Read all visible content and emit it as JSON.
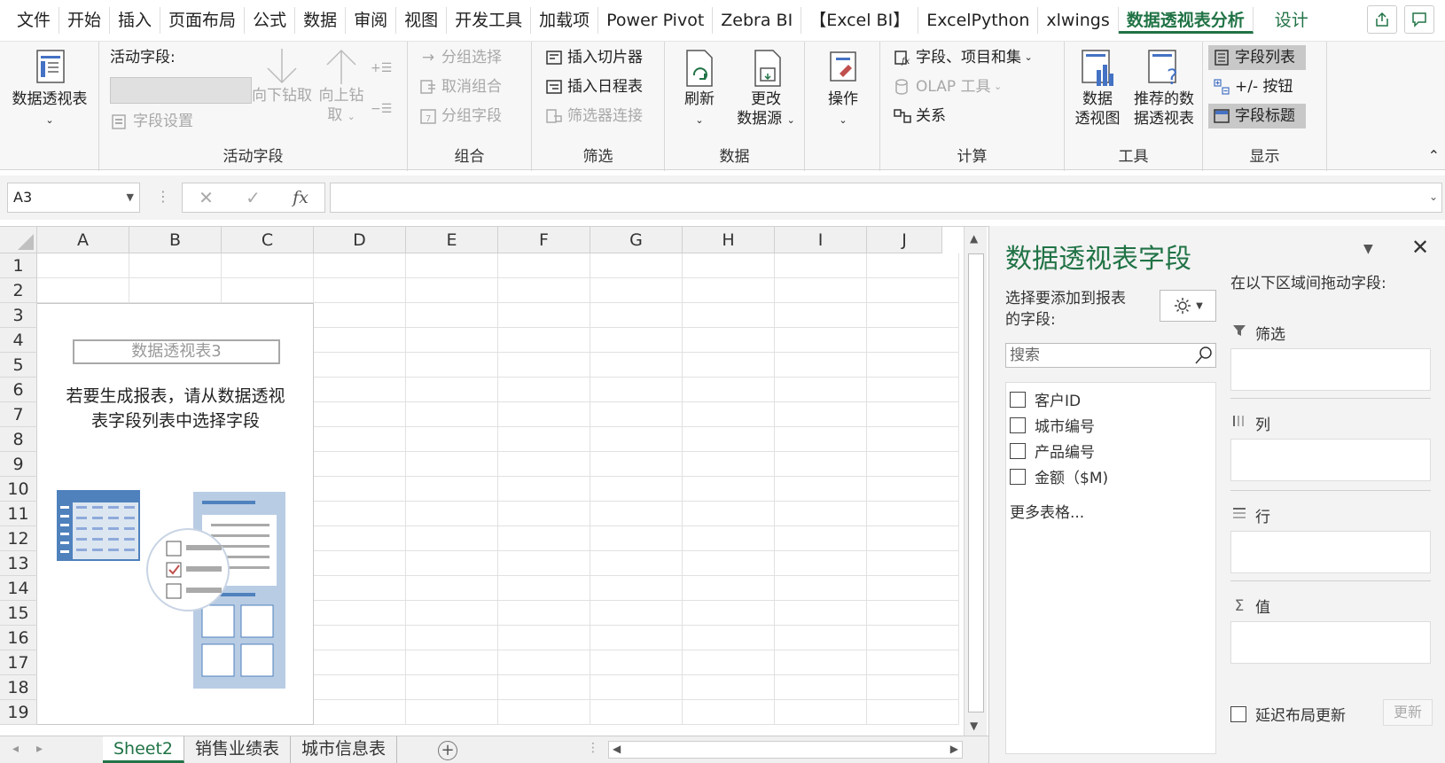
{
  "menu": {
    "tabs": [
      "文件",
      "开始",
      "插入",
      "页面布局",
      "公式",
      "数据",
      "审阅",
      "视图",
      "开发工具",
      "加载项",
      "Power Pivot",
      "Zebra BI",
      "【Excel BI】",
      "ExcelPython",
      "xlwings",
      "数据透视表分析",
      "设计"
    ],
    "active_tab": "数据透视表分析"
  },
  "ribbon": {
    "pivottable": {
      "label": "数据透视表"
    },
    "active_field": {
      "field_label": "活动字段:",
      "field_settings": "字段设置",
      "drill_down": "向下钻取",
      "drill_up_line1": "向上钻",
      "drill_up_line2": "取",
      "group_label": "活动字段"
    },
    "group": {
      "group_selection": "分组选择",
      "ungroup": "取消组合",
      "group_field": "分组字段",
      "group_label": "组合"
    },
    "filter": {
      "insert_slicer": "插入切片器",
      "insert_timeline": "插入日程表",
      "filter_connections": "筛选器连接",
      "group_label": "筛选"
    },
    "data": {
      "refresh": "刷新",
      "change_source_line1": "更改",
      "change_source_line2": "数据源",
      "group_label": "数据"
    },
    "actions": {
      "label": "操作"
    },
    "calc": {
      "fields_items_sets": "字段、项目和集",
      "olap_tools": "OLAP 工具",
      "relationships": "关系",
      "group_label": "计算"
    },
    "tools": {
      "pivotchart_line1": "数据",
      "pivotchart_line2": "透视图",
      "recommended_line1": "推荐的数",
      "recommended_line2": "据透视表",
      "group_label": "工具"
    },
    "show": {
      "field_list": "字段列表",
      "buttons": "+/- 按钮",
      "field_headers": "字段标题",
      "group_label": "显示"
    }
  },
  "formula_bar": {
    "name_box": "A3",
    "fx_label": "fx",
    "formula": ""
  },
  "grid": {
    "columns": [
      "A",
      "B",
      "C",
      "D",
      "E",
      "F",
      "G",
      "H",
      "I",
      "J"
    ],
    "rows": [
      "1",
      "2",
      "3",
      "4",
      "5",
      "6",
      "7",
      "8",
      "9",
      "10",
      "11",
      "12",
      "13",
      "14",
      "15",
      "16",
      "17",
      "18",
      "19"
    ]
  },
  "pivot_placeholder": {
    "name": "数据透视表3",
    "message_line1": "若要生成报表，请从数据透视",
    "message_line2": "表字段列表中选择字段"
  },
  "sheets": {
    "tabs": [
      "Sheet2",
      "销售业绩表",
      "城市信息表"
    ],
    "active": "Sheet2"
  },
  "field_pane": {
    "title": "数据透视表字段",
    "choose_fields_line1": "选择要添加到报表",
    "choose_fields_line2": "的字段:",
    "search_placeholder": "搜索",
    "fields": [
      "客户ID",
      "城市编号",
      "产品编号",
      "金额（$M)"
    ],
    "more_tables": "更多表格...",
    "drag_hint": "在以下区域间拖动字段:",
    "zones": {
      "filters": "筛选",
      "columns": "列",
      "rows": "行",
      "values": "值"
    },
    "defer_update": "延迟布局更新",
    "update_button": "更新"
  },
  "colors": {
    "accent": "#217346",
    "disabled": "#a8a8a8"
  }
}
